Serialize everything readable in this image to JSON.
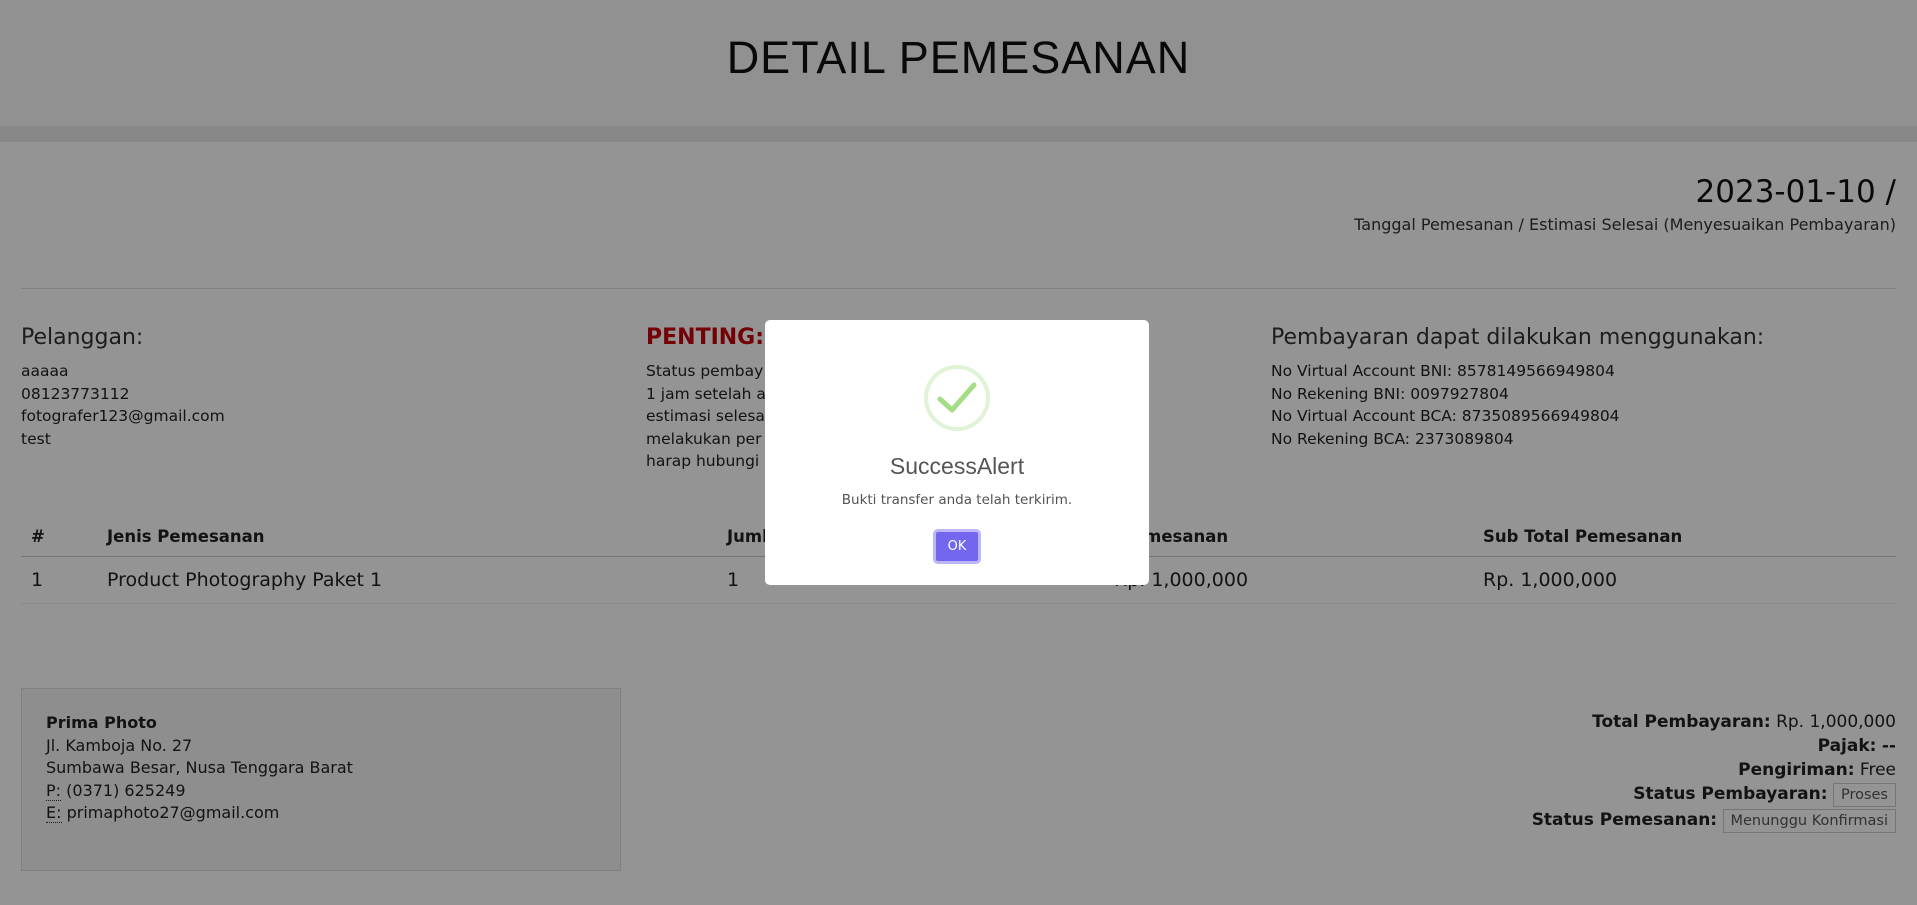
{
  "page": {
    "title": "DETAIL PEMESANAN"
  },
  "dates": {
    "value": "2023-01-10 /",
    "caption": "Tanggal Pemesanan / Estimasi Selesai (Menyesuaikan Pembayaran)"
  },
  "customer": {
    "heading": "Pelanggan:",
    "name": "aaaaa",
    "phone": "08123773112",
    "email": "fotografer123@gmail.com",
    "note": "test"
  },
  "important": {
    "heading": "PENTING:",
    "lines": [
      "Status pembay",
      "1 jam setelah a",
      "estimasi selesa",
      "melakukan per",
      "harap hubungi"
    ]
  },
  "payment": {
    "heading": "Pembayaran dapat dilakukan menggunakan:",
    "lines": [
      "No Virtual Account BNI: 8578149566949804",
      "No Rekening BNI: 0097927804",
      "No Virtual Account BCA: 8735089566949804",
      "No Rekening BCA: 2373089804"
    ]
  },
  "table": {
    "headers": [
      "#",
      "Jenis Pemesanan",
      "Jumla",
      "a Pemesanan",
      "Sub Total Pemesanan"
    ],
    "rows": [
      [
        "1",
        "Product Photography Paket 1",
        "1",
        "Rp. 1,000,000",
        "Rp. 1,000,000"
      ]
    ]
  },
  "company": {
    "name": "Prima Photo",
    "address1": "Jl. Kamboja No. 27",
    "address2": "Sumbawa Besar, Nusa Tenggara Barat",
    "phone_label": "P:",
    "phone": "(0371) 625249",
    "email_label": "E:",
    "email": "primaphoto27@gmail.com"
  },
  "summary": {
    "total_label": "Total Pembayaran:",
    "total_value": "Rp. 1,000,000",
    "tax_label": "Pajak:",
    "tax_value": "--",
    "shipping_label": "Pengiriman:",
    "shipping_value": "Free",
    "payment_status_label": "Status Pembayaran:",
    "payment_status_value": "Proses",
    "order_status_label": "Status Pemesanan:",
    "order_status_value": "Menunggu Konfirmasi"
  },
  "modal": {
    "title": "SuccessAlert",
    "text": "Bukti transfer anda telah terkirim.",
    "ok_label": "OK",
    "icon": "checkmark-icon",
    "accent": "#7367f0",
    "check_color": "#a5dc86"
  }
}
